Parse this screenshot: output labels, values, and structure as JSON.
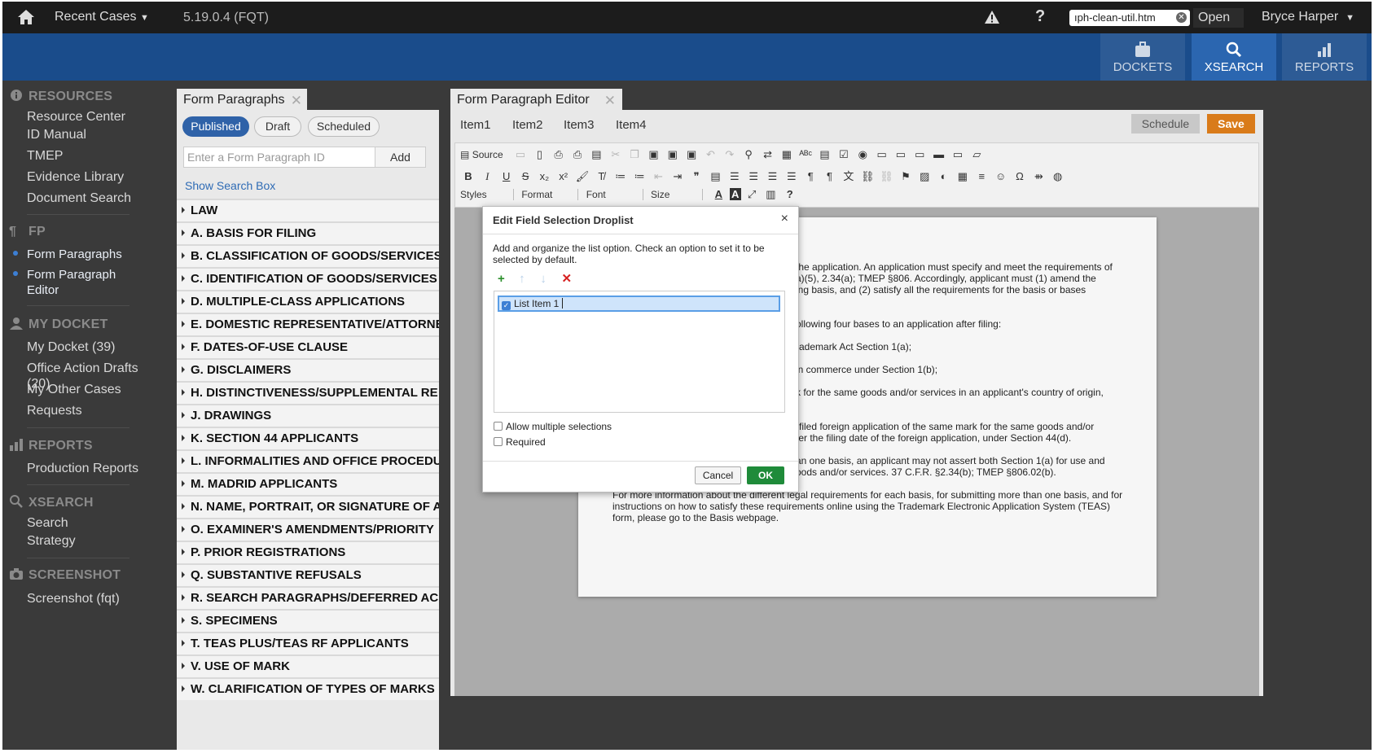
{
  "topbar": {
    "recent_cases": "Recent Cases",
    "version": "5.19.0.4 (FQT)",
    "help": "?",
    "url_value": "ıph-clean-util.htm",
    "open_label": "Open",
    "user_name": "Bryce Harper"
  },
  "header_buttons": {
    "dockets": "DOCKETS",
    "xsearch": "XSEARCH",
    "reports": "REPORTS"
  },
  "sidebar": {
    "resources": {
      "heading": "RESOURCES",
      "items": [
        "Resource Center",
        "ID Manual",
        "TMEP",
        "Evidence Library",
        "Document Search"
      ]
    },
    "fp": {
      "heading": "FP",
      "items": [
        "Form Paragraphs",
        "Form Paragraph",
        "Editor"
      ]
    },
    "my_docket": {
      "heading": "MY DOCKET",
      "items": [
        "My Docket (39)",
        "Office Action Drafts (20)",
        "My Other Cases",
        "Requests"
      ]
    },
    "reports": {
      "heading": "REPORTS",
      "items": [
        "Production Reports"
      ]
    },
    "xsearch": {
      "heading": "XSEARCH",
      "items": [
        "Search",
        "Strategy"
      ]
    },
    "screenshot": {
      "heading": "SCREENSHOT",
      "items": [
        "Screenshot (fqt)"
      ]
    }
  },
  "form_paragraphs": {
    "tab_title": "Form Paragraphs",
    "filters": [
      "Published",
      "Draft",
      "Scheduled"
    ],
    "id_placeholder": "Enter a Form Paragraph ID",
    "add_label": "Add",
    "show_search": "Show Search Box",
    "sections": [
      "LAW",
      "A. BASIS FOR FILING",
      "B. CLASSIFICATION OF GOODS/SERVICES",
      "C. IDENTIFICATION OF GOODS/SERVICES",
      "D. MULTIPLE-CLASS APPLICATIONS",
      "E. DOMESTIC REPRESENTATIVE/ATTORNEY",
      "F. DATES-OF-USE CLAUSE",
      "G. DISCLAIMERS",
      "H. DISTINCTIVENESS/SUPPLEMENTAL RE",
      "J. DRAWINGS",
      "K. SECTION 44 APPLICANTS",
      "L. INFORMALITIES AND OFFICE PROCEDU",
      "M. MADRID APPLICANTS",
      "N. NAME, PORTRAIT, OR SIGNATURE OF A",
      "O. EXAMINER'S AMENDMENTS/PRIORITY",
      "P. PRIOR REGISTRATIONS",
      "Q. SUBSTANTIVE REFUSALS",
      "R. SEARCH PARAGRAPHS/DEFERRED AC",
      "S. SPECIMENS",
      "T. TEAS PLUS/TEAS RF APPLICANTS",
      "V. USE OF MARK",
      "W. CLARIFICATION OF TYPES OF MARKS"
    ]
  },
  "editor": {
    "tab_title": "Form Paragraph Editor",
    "menu": [
      "Item1",
      "Item2",
      "Item3",
      "Item4"
    ],
    "schedule_label": "Schedule",
    "save_label": "Save",
    "toolbar": {
      "source": "Source",
      "styles": "Styles",
      "format": "Format",
      "font": "Font",
      "size": "Size"
    },
    "document_lines": [
      "the application. An application must specify and meet the requirements of",
      "a)(5), 2.34(a); TMEP §806. Accordingly, applicant must (1) amend the",
      "ing basis, and (2) satisfy all the requirements for the basis or bases",
      "ollowing four bases to an application after filing:",
      "rademark Act Section 1(a);",
      "in commerce under Section 1(b);",
      "k for the same goods and/or services in an applicant's country of origin,",
      "-filed foreign application of the same mark for the same goods and/or",
      "ter the filing date of the foreign application, under Section 44(d).",
      "an one basis, an applicant may not assert both Section 1(a) for use and",
      "oods and/or services. 37 C.F.R. §2.34(b); TMEP §806.02(b).",
      "For more information about the different legal requirements for each basis, for submitting more than one basis, and for",
      "instructions on how to satisfy these requirements online using the Trademark Electronic Application System (TEAS)",
      "form, please go to the Basis webpage."
    ]
  },
  "modal": {
    "title": "Edit Field Selection Droplist",
    "close": "×",
    "description": "Add and organize the list option. Check an option to set it to be selected by default.",
    "list_item": "List Item 1",
    "allow_multiple": "Allow multiple selections",
    "required": "Required",
    "cancel_label": "Cancel",
    "ok_label": "OK"
  },
  "colors": {
    "brand_blue": "#1a4c8b",
    "save_orange": "#d97b1a",
    "ok_green": "#1f8b3a",
    "published_blue": "#2f62a8"
  }
}
